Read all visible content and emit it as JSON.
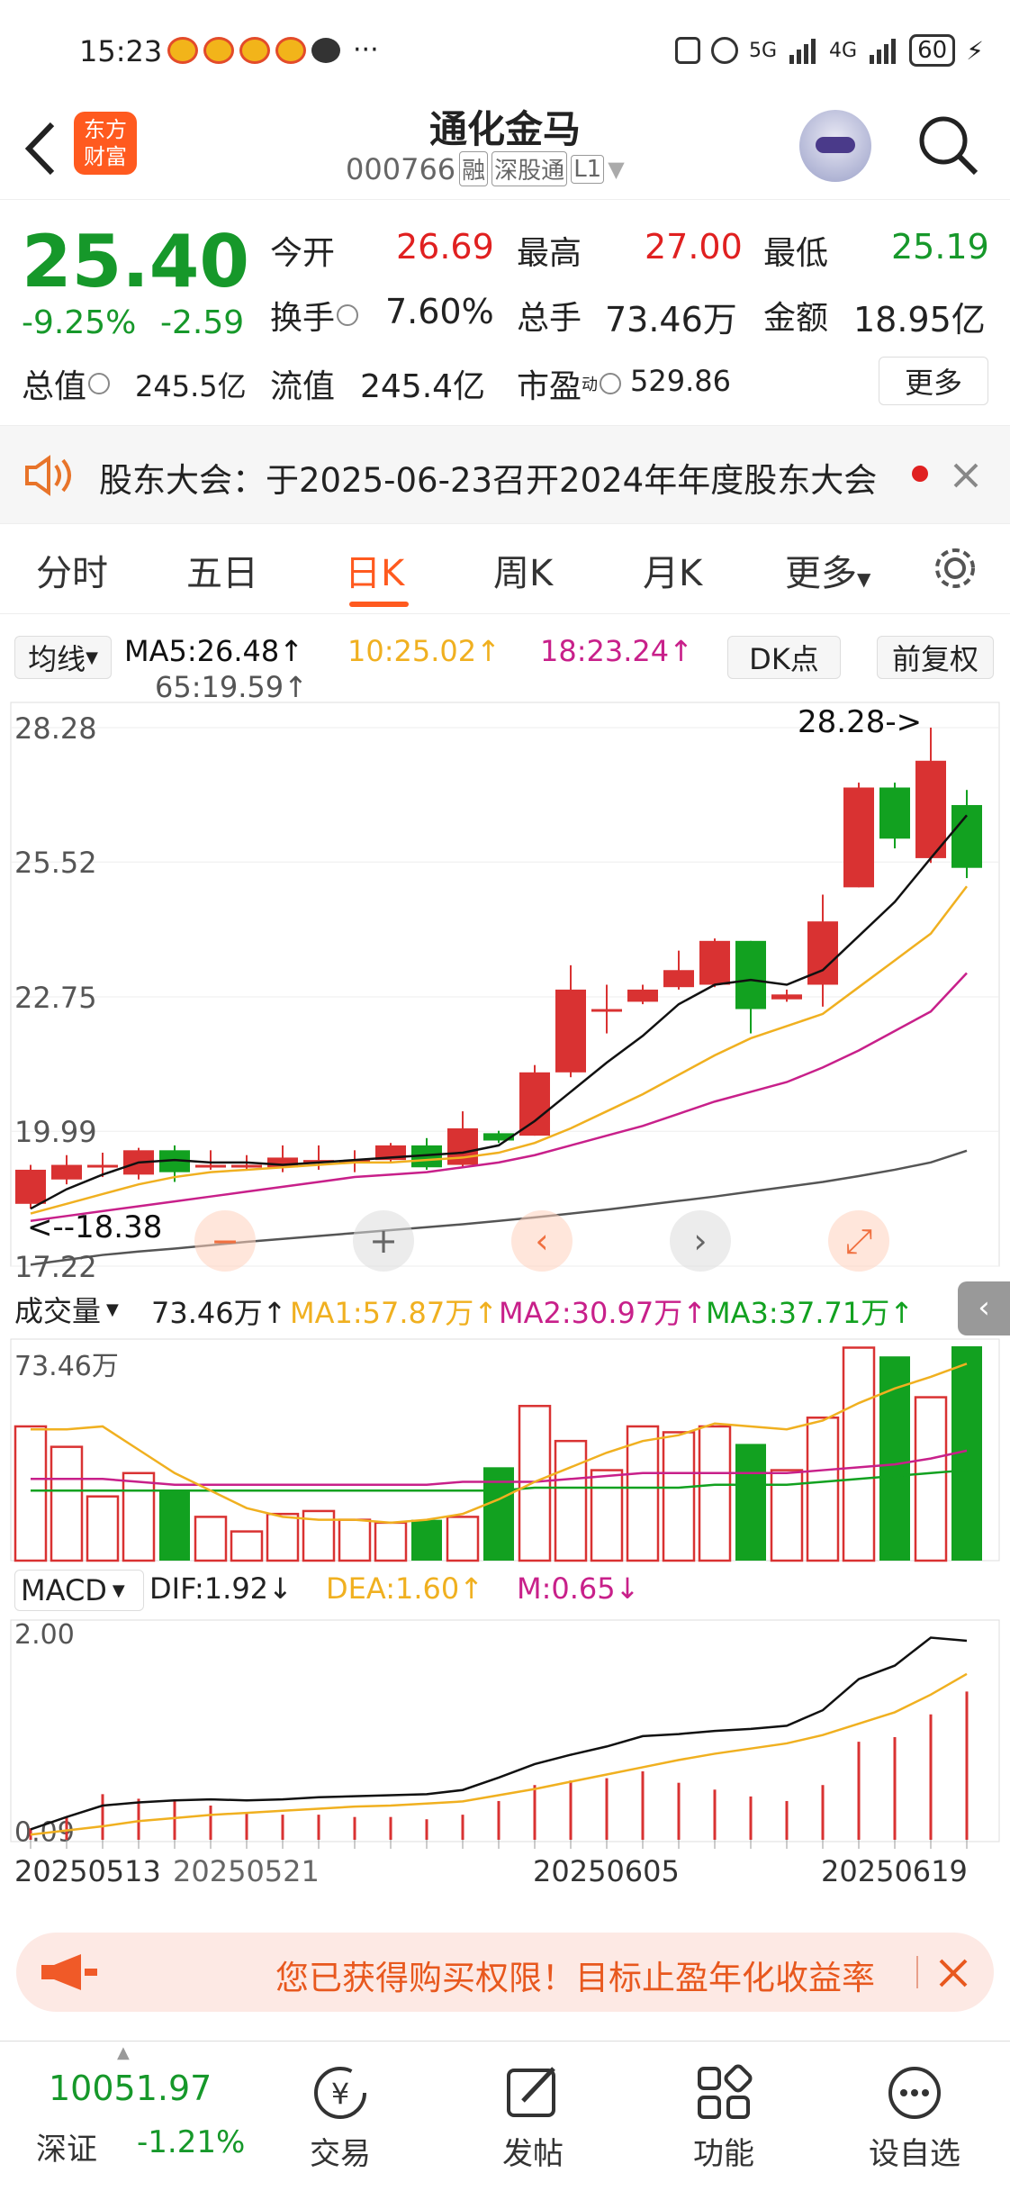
{
  "status_bar": {
    "time": "15:23",
    "dots": "···",
    "battery": "60",
    "net1": "5G",
    "net2": "4G"
  },
  "header": {
    "title": "通化金马",
    "code": "000766",
    "tags": [
      "融",
      "深股通",
      "L1"
    ],
    "logo_text": [
      "东方",
      "财富"
    ]
  },
  "quote": {
    "price": "25.40",
    "change_pct": "-9.25%",
    "change": "-2.59",
    "open_label": "今开",
    "open": "26.69",
    "high_label": "最高",
    "high": "27.00",
    "low_label": "最低",
    "low": "25.19",
    "turnover_label": "换手",
    "turnover": "7.60%",
    "volume_label": "总手",
    "volume": "73.46万",
    "amount_label": "金额",
    "amount": "18.95亿",
    "mktcap_label": "总值",
    "mktcap": "245.5亿",
    "float_label": "流值",
    "float": "245.4亿",
    "pe_label": "市盈",
    "pe_sup": "动",
    "pe": "529.86",
    "more_label": "更多"
  },
  "notice": {
    "text": "股东大会：于2025-06-23召开2024年年度股东大会"
  },
  "tabs": [
    "分时",
    "五日",
    "日K",
    "周K",
    "月K",
    "更多"
  ],
  "active_tab": "日K",
  "ma_bar": {
    "selector": "均线",
    "ma5": "MA5:26.48↑",
    "ma10": "10:25.02↑",
    "ma18": "18:23.24↑",
    "ma65": "65:19.59↑",
    "dk": "DK点",
    "fq": "前复权"
  },
  "vol_bar": {
    "selector": "成交量",
    "vol": "73.46万↑",
    "ma1": "MA1:57.87万↑",
    "ma2": "MA2:30.97万↑",
    "ma3": "MA3:37.71万↑"
  },
  "macd_bar": {
    "selector": "MACD",
    "dif": "DIF:1.92↓",
    "dea": "DEA:1.60↑",
    "m": "M:0.65↓"
  },
  "chart_data": [
    {
      "type": "candlestick",
      "y_ticks": [
        "28.28",
        "25.52",
        "22.75",
        "19.99",
        "17.22"
      ],
      "ylim": [
        17.22,
        28.28
      ],
      "max_label": "28.28->",
      "min_label": "<--18.38",
      "x_labels": [
        "20250513",
        "20250521",
        "20250605",
        "20250619"
      ],
      "candles": [
        {
          "o": 18.5,
          "c": 19.2,
          "h": 19.3,
          "l": 18.4
        },
        {
          "o": 19.0,
          "c": 19.3,
          "h": 19.5,
          "l": 18.9
        },
        {
          "o": 19.3,
          "c": 19.3,
          "h": 19.55,
          "l": 19.05
        },
        {
          "o": 19.1,
          "c": 19.6,
          "h": 19.65,
          "l": 19.0
        },
        {
          "o": 19.6,
          "c": 19.15,
          "h": 19.7,
          "l": 18.95
        },
        {
          "o": 19.3,
          "c": 19.3,
          "h": 19.6,
          "l": 19.2
        },
        {
          "o": 19.25,
          "c": 19.3,
          "h": 19.5,
          "l": 19.2
        },
        {
          "o": 19.25,
          "c": 19.45,
          "h": 19.7,
          "l": 19.15
        },
        {
          "o": 19.4,
          "c": 19.4,
          "h": 19.7,
          "l": 19.2
        },
        {
          "o": 19.4,
          "c": 19.4,
          "h": 19.6,
          "l": 19.15
        },
        {
          "o": 19.4,
          "c": 19.7,
          "h": 19.75,
          "l": 19.35
        },
        {
          "o": 19.7,
          "c": 19.25,
          "h": 19.85,
          "l": 19.2
        },
        {
          "o": 19.3,
          "c": 20.05,
          "h": 20.4,
          "l": 19.25
        },
        {
          "o": 19.95,
          "c": 19.8,
          "h": 20.0,
          "l": 19.75
        },
        {
          "o": 19.9,
          "c": 21.2,
          "h": 21.35,
          "l": 19.9
        },
        {
          "o": 21.2,
          "c": 22.9,
          "h": 23.4,
          "l": 21.1
        },
        {
          "o": 22.5,
          "c": 22.5,
          "h": 23.0,
          "l": 22.0
        },
        {
          "o": 22.65,
          "c": 22.9,
          "h": 23.0,
          "l": 22.6
        },
        {
          "o": 22.95,
          "c": 23.3,
          "h": 23.7,
          "l": 22.9
        },
        {
          "o": 23.0,
          "c": 23.9,
          "h": 23.95,
          "l": 22.95
        },
        {
          "o": 23.9,
          "c": 22.5,
          "h": 23.9,
          "l": 22.0
        },
        {
          "o": 22.7,
          "c": 22.8,
          "h": 22.9,
          "l": 22.65
        },
        {
          "o": 23.0,
          "c": 24.3,
          "h": 24.85,
          "l": 22.55
        },
        {
          "o": 25.0,
          "c": 27.05,
          "h": 27.15,
          "l": 25.0
        },
        {
          "o": 27.05,
          "c": 26.0,
          "h": 27.15,
          "l": 25.8
        },
        {
          "o": 25.6,
          "c": 27.6,
          "h": 28.28,
          "l": 25.5
        },
        {
          "o": 26.69,
          "c": 25.4,
          "h": 27.0,
          "l": 25.19
        }
      ],
      "ma5": [
        18.4,
        18.8,
        19.1,
        19.35,
        19.4,
        19.35,
        19.35,
        19.3,
        19.35,
        19.4,
        19.45,
        19.5,
        19.55,
        19.7,
        20.2,
        20.8,
        21.4,
        21.95,
        22.6,
        23.0,
        23.1,
        23.0,
        23.3,
        24.0,
        24.7,
        25.6,
        26.48
      ],
      "ma10": [
        18.3,
        18.5,
        18.7,
        18.9,
        19.05,
        19.15,
        19.2,
        19.25,
        19.3,
        19.35,
        19.35,
        19.4,
        19.45,
        19.55,
        19.75,
        20.05,
        20.4,
        20.75,
        21.15,
        21.55,
        21.9,
        22.15,
        22.4,
        22.95,
        23.5,
        24.05,
        25.02
      ],
      "ma18": [
        18.15,
        18.25,
        18.35,
        18.45,
        18.55,
        18.65,
        18.75,
        18.85,
        18.95,
        19.05,
        19.1,
        19.15,
        19.25,
        19.35,
        19.5,
        19.7,
        19.9,
        20.1,
        20.35,
        20.6,
        20.8,
        21.0,
        21.3,
        21.65,
        22.05,
        22.45,
        23.24
      ],
      "ma65": [
        17.25,
        17.35,
        17.45,
        17.52,
        17.58,
        17.65,
        17.72,
        17.78,
        17.84,
        17.9,
        17.96,
        18.02,
        18.08,
        18.15,
        18.22,
        18.3,
        18.38,
        18.47,
        18.56,
        18.65,
        18.75,
        18.85,
        18.95,
        19.07,
        19.2,
        19.35,
        19.59
      ]
    },
    {
      "type": "bar",
      "name": "成交量",
      "y_tick": "73.46万",
      "ylim": [
        0,
        73.46
      ],
      "values": [
        46,
        39,
        22,
        30,
        24,
        15,
        10,
        16,
        17,
        14,
        13,
        14,
        15,
        32,
        53,
        41,
        31,
        46,
        44,
        46,
        40,
        31,
        49,
        73,
        70,
        56,
        73.46
      ],
      "ma1": [
        45,
        45,
        46,
        38,
        30,
        24,
        18,
        15,
        14,
        14,
        13,
        14,
        16,
        21,
        27,
        32,
        37,
        41,
        43,
        47,
        46,
        45,
        48,
        54,
        59,
        63,
        67.5
      ],
      "ma2": [
        28,
        28,
        28,
        27,
        26,
        26,
        26,
        26,
        26,
        26,
        26,
        26,
        27,
        27,
        27,
        28,
        29,
        30,
        30,
        30,
        30,
        30,
        31,
        32,
        33,
        35,
        37.7
      ],
      "ma3": [
        24,
        24,
        24,
        24,
        24,
        24,
        24,
        24,
        24,
        24,
        24,
        24,
        24,
        24,
        25,
        25,
        25,
        25,
        25,
        26,
        26,
        26,
        27,
        28,
        29,
        30,
        31
      ]
    },
    {
      "type": "bar",
      "name": "MACD",
      "y_ticks": [
        "2.00",
        "0.09"
      ],
      "ylim": [
        0.09,
        2.0
      ],
      "dif": [
        0.1,
        0.22,
        0.33,
        0.36,
        0.38,
        0.39,
        0.38,
        0.39,
        0.41,
        0.42,
        0.43,
        0.44,
        0.48,
        0.6,
        0.73,
        0.82,
        0.9,
        1.0,
        1.02,
        1.05,
        1.07,
        1.1,
        1.25,
        1.55,
        1.68,
        1.95,
        1.92
      ],
      "dea": [
        0.05,
        0.09,
        0.13,
        0.18,
        0.21,
        0.24,
        0.26,
        0.28,
        0.3,
        0.32,
        0.33,
        0.35,
        0.37,
        0.43,
        0.49,
        0.56,
        0.63,
        0.7,
        0.77,
        0.83,
        0.88,
        0.93,
        1.01,
        1.12,
        1.23,
        1.4,
        1.6
      ],
      "m": [
        0.05,
        0.1,
        0.2,
        0.18,
        0.17,
        0.15,
        0.12,
        0.11,
        0.11,
        0.1,
        0.1,
        0.09,
        0.11,
        0.17,
        0.24,
        0.26,
        0.27,
        0.3,
        0.25,
        0.22,
        0.19,
        0.17,
        0.24,
        0.43,
        0.45,
        0.55,
        0.65
      ]
    }
  ],
  "promo": {
    "text": "您已获得购买权限！目标止盈年化收益率"
  },
  "bottom_nav": {
    "index_value": "10051.97",
    "index_name": "深证",
    "index_change": "-1.21%",
    "items": [
      "交易",
      "发帖",
      "功能",
      "设自选"
    ]
  },
  "colors": {
    "up": "#d93232",
    "down": "#12a120",
    "ma5": "#111111",
    "ma10": "#f0b020",
    "ma18": "#c8208a",
    "ma65": "#555555",
    "accent": "#ff6a1a"
  }
}
